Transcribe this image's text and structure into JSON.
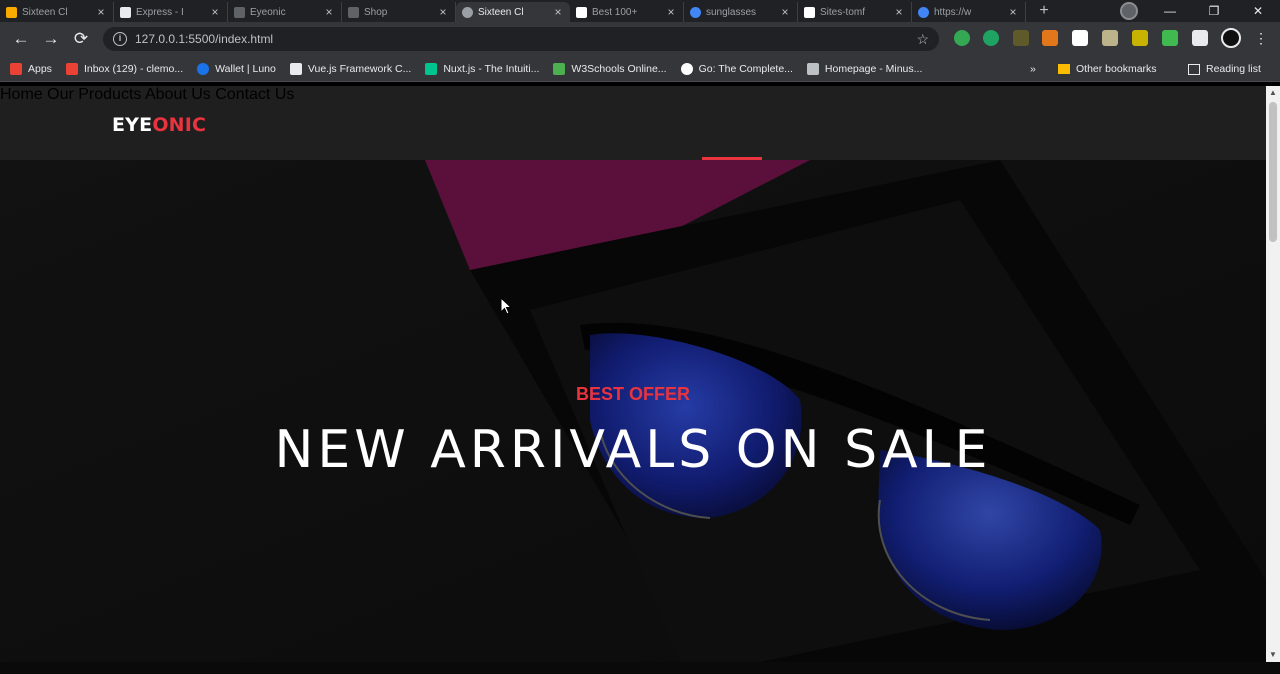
{
  "browser": {
    "tabs": [
      {
        "title": "Sixteen Cl",
        "color": "#f9ab00"
      },
      {
        "title": "Express - I",
        "color": "#e8eaed"
      },
      {
        "title": "Eyeonic",
        "color": "#5f6368"
      },
      {
        "title": "Shop",
        "color": "#5f6368"
      },
      {
        "title": "Sixteen Cl",
        "color": "#9aa0a6"
      },
      {
        "title": "Best 100+",
        "color": "#ffffff"
      },
      {
        "title": "sunglasses",
        "color": "#4285f4"
      },
      {
        "title": "Sites-tomf",
        "color": "#ffffff"
      },
      {
        "title": "https://w",
        "color": "#4285f4"
      }
    ],
    "active_tab_index": 4,
    "new_tab_glyph": "+",
    "tab_close_glyph": "×",
    "window_controls": [
      "—",
      "❐",
      "✕"
    ],
    "nav": {
      "back": "←",
      "forward": "→",
      "reload": "⟳"
    },
    "url": "127.0.0.1:5500/index.html",
    "star_glyph": "☆",
    "bookmarks": [
      {
        "label": "Apps",
        "icon": "apps-grid-icon",
        "color": "#ea4335"
      },
      {
        "label": "Inbox (129) - clemo...",
        "icon": "gmail-icon",
        "color": "#ea4335"
      },
      {
        "label": "Wallet | Luno",
        "icon": "luno-icon",
        "color": "#1a73e8"
      },
      {
        "label": "Vue.js Framework C...",
        "icon": "vue-icon",
        "color": "#e8eaed"
      },
      {
        "label": "Nuxt.js - The Intuiti...",
        "icon": "nuxt-icon",
        "color": "#00c58e"
      },
      {
        "label": "W3Schools Online...",
        "icon": "w3schools-icon",
        "color": "#4caf50"
      },
      {
        "label": "Go: The Complete...",
        "icon": "udemy-icon",
        "color": "#ffffff"
      },
      {
        "label": "Homepage - Minus...",
        "icon": "minus-icon",
        "color": "#bdc1c6"
      }
    ],
    "more_bookmarks_glyph": "»",
    "other_bookmarks": "Other bookmarks",
    "reading_list": "Reading list"
  },
  "site": {
    "logo_part1": "EYE",
    "logo_part2": "ONIC",
    "nav": [
      {
        "label": "Home",
        "active": true
      },
      {
        "label": "Our Products",
        "active": false
      },
      {
        "label": "About Us",
        "active": false
      },
      {
        "label": "Contact Us",
        "active": false
      }
    ],
    "accent_color": "#e9333f",
    "hero": {
      "kicker": "BEST OFFER",
      "headline": "NEW ARRIVALS ON SALE",
      "image_subject": "sunglasses in box"
    }
  }
}
